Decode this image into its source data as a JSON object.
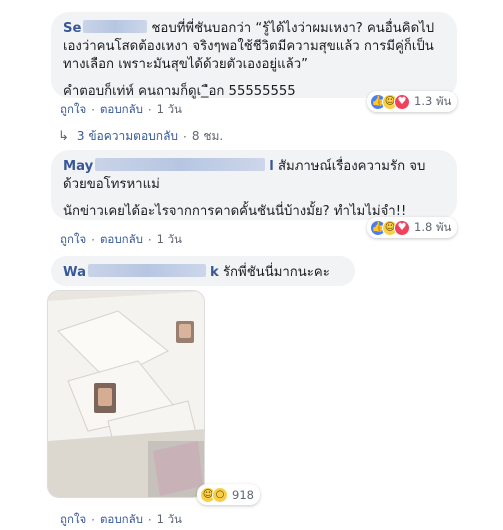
{
  "comments": [
    {
      "author_visible": "Se",
      "text_lines": [
        "ชอบที่พี่ชันบอกว่า “รู้ได้ไงว่าผมเหงา? คนอื่นคิดไป\nเองว่าคนโสดต้องเหงา จริงๆพอใช้ชีวิตมีความสุขแล้ว การมีคู่ก็เป็น\nทางเลือก เพราะมันสุขได้ด้วยตัวเองอยู่แล้ว”",
        "คำตอบก็เท่ห์ คนถามก็ดูเ_ือก 55555555"
      ],
      "actions": {
        "like": "ถูกใจ",
        "reply": "ตอบกลับ",
        "time": "1 วัน"
      },
      "reactions": {
        "icons": [
          "like-icon",
          "haha-icon",
          "love-icon"
        ],
        "count": "1.3 พัน"
      }
    },
    {
      "author_visible": "May",
      "author_suffix": "l",
      "text_lines": [
        "สัมภาษณ์เรื่องความรัก จบ\nด้วยขอโทรหาแม่",
        "นักข่าวเคยได้อะไรจากการคาดคั้นชันนี่บ้างมั้ย? ทำไมไม่จำ!!"
      ],
      "actions": {
        "like": "ถูกใจ",
        "reply": "ตอบกลับ",
        "time": "1 วัน"
      },
      "reactions": {
        "icons": [
          "like-icon",
          "haha-icon",
          "love-icon"
        ],
        "count": "1.8 พัน"
      }
    },
    {
      "author_visible": "Wa",
      "author_suffix": "k",
      "text_lines": [
        "รักพี่ชันนี่มากนะคะ"
      ],
      "actions": {
        "like": "ถูกใจ",
        "reply": "ตอบกลับ",
        "time": "1 วัน"
      },
      "reactions": {
        "icons": [
          "haha-icon",
          "wow-icon"
        ],
        "count": "918"
      }
    }
  ],
  "replies_link": {
    "label": "3 ข้อความตอบกลับ",
    "time": "8 ชม."
  },
  "colors": {
    "link": "#385898",
    "bubble": "#f2f3f5",
    "meta": "#606770"
  }
}
